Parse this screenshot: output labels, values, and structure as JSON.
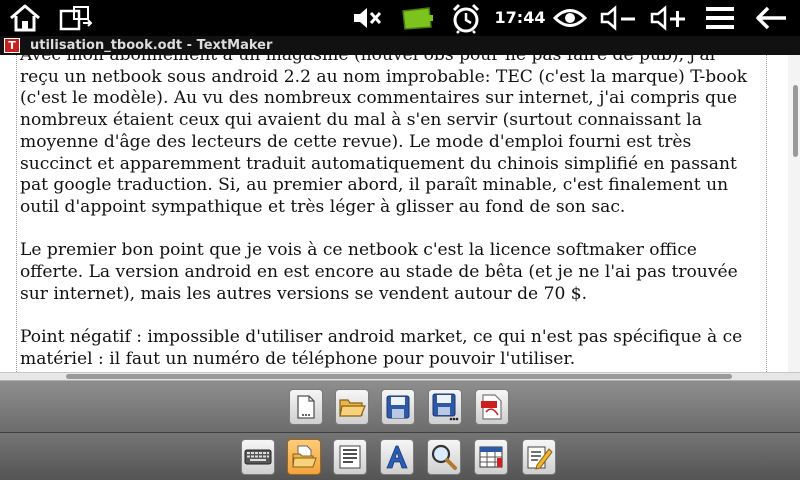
{
  "status_bar": {
    "time": "17:44",
    "icons": [
      "home-icon",
      "switch-windows-icon",
      "mute-icon",
      "battery-icon",
      "alarm-icon",
      "eye-icon",
      "volume-down-icon",
      "volume-up-icon",
      "menu-icon",
      "back-icon"
    ]
  },
  "window": {
    "app_logo_letter": "T",
    "title": "utilisation_tbook.odt - TextMaker"
  },
  "document": {
    "paragraphs": [
      {
        "lines": [
          "Avec mon abonnement à un magasine (nouvel obs pour ne pas faire de pub), j'ai",
          "reçu un netbook sous android 2.2 au nom improbable: TEC (c'est la marque) T-book",
          "(c'est le modèle). Au vu des nombreux commentaires sur internet, j'ai compris que",
          "nombreux étaient ceux qui avaient du mal à s'en servir (surtout connaissant la",
          "moyenne d'âge des lecteurs de cette revue). Le mode d'emploi fourni est très",
          "succinct et apparemment traduit automatiquement du chinois simplifié en passant",
          "pat google traduction. Si, au premier abord, il paraît minable, c'est finalement un",
          "outil d'appoint sympathique et très léger à glisser au fond de son sac."
        ]
      },
      {
        "lines": [
          "Le premier bon point que je vois à ce netbook c'est la licence softmaker office",
          "offerte. La version android en est encore au stade de bêta (et je ne l'ai pas trouvée",
          "sur internet), mais les autres versions se vendent autour de 70 $."
        ]
      },
      {
        "lines": [
          "Point négatif : impossible d'utiliser android market, ce qui n'est pas spécifique à ce",
          "matériel : il faut un numéro de téléphone pour pouvoir l'utiliser."
        ]
      }
    ]
  },
  "toolbar_top": {
    "buttons": [
      "new-document",
      "open-folder",
      "save",
      "save-as",
      "export-pdf"
    ]
  },
  "toolbar_bottom": {
    "buttons": [
      "keyboard",
      "file-menu",
      "paragraph",
      "character-format",
      "zoom",
      "table",
      "edit"
    ],
    "active": "file-menu"
  },
  "colors": {
    "accent": "#f2a43c",
    "logo": "#c8201f",
    "battery": "#7dc31e"
  }
}
